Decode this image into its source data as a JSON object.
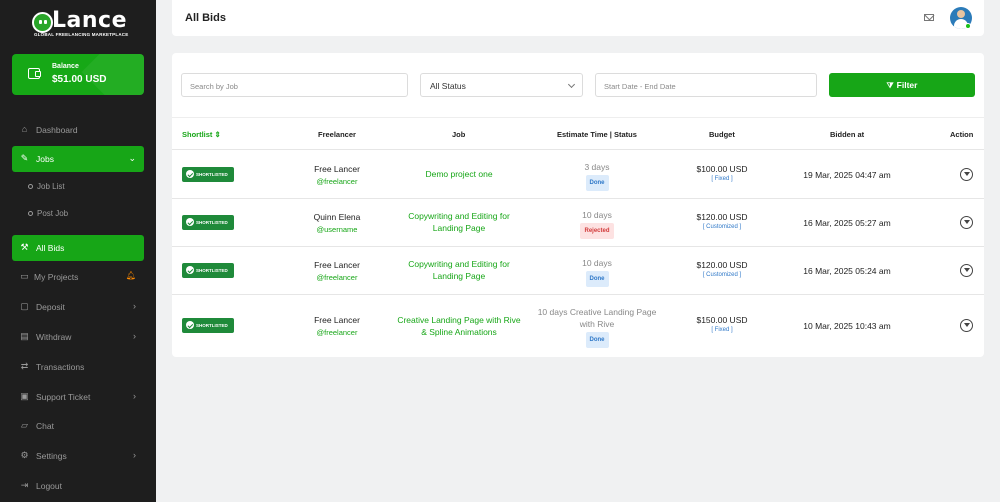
{
  "brand": {
    "name": "Lance",
    "tagline": "GLOBAL FREELANCING MARKETPLACE"
  },
  "balance": {
    "label": "Balance",
    "value": "$51.00 USD"
  },
  "sidebar": {
    "items": [
      {
        "label": "Dashboard",
        "icon": "home-icon"
      },
      {
        "label": "Jobs",
        "icon": "pen-icon"
      },
      {
        "label": "Job List"
      },
      {
        "label": "Post Job"
      },
      {
        "label": "All Bids",
        "icon": "hammer-icon"
      },
      {
        "label": "My Projects",
        "icon": "folder-icon"
      },
      {
        "label": "Deposit",
        "icon": "wallet-icon"
      },
      {
        "label": "Withdraw",
        "icon": "card-icon"
      },
      {
        "label": "Transactions",
        "icon": "transfer-icon"
      },
      {
        "label": "Support Ticket",
        "icon": "ticket-icon"
      },
      {
        "label": "Chat",
        "icon": "chat-icon"
      },
      {
        "label": "Settings",
        "icon": "gear-icon"
      },
      {
        "label": "Logout",
        "icon": "logout-icon"
      }
    ]
  },
  "header": {
    "title": "All Bids"
  },
  "filters": {
    "search_placeholder": "Search by Job",
    "status_value": "All Status",
    "date_placeholder": "Start Date - End Date",
    "filter_label": "Filter"
  },
  "table": {
    "headers": [
      "Shortlist",
      "Freelancer",
      "Job",
      "Estimate Time | Status",
      "Budget",
      "Bidden at",
      "Action"
    ],
    "shortlist_badge": "SHORTLISTED",
    "rows": [
      {
        "name": "Free Lancer",
        "username": "@freelancer",
        "job": "Demo project one",
        "estimate": "3 days",
        "status": "Done",
        "budget": "$100.00 USD",
        "type": "[ Fixed ]",
        "bidden_at": "19 Mar, 2025 04:47 am"
      },
      {
        "name": "Quinn Elena",
        "username": "@username",
        "job": "Copywriting and Editing for Landing Page",
        "estimate": "10 days",
        "status": "Rejected",
        "budget": "$120.00 USD",
        "type": "[ Customized ]",
        "bidden_at": "16 Mar, 2025 05:27 am"
      },
      {
        "name": "Free Lancer",
        "username": "@freelancer",
        "job": "Copywriting and Editing for Landing Page",
        "estimate": "10 days",
        "status": "Done",
        "budget": "$120.00 USD",
        "type": "[ Customized ]",
        "bidden_at": "16 Mar, 2025 05:24 am"
      },
      {
        "name": "Free Lancer",
        "username": "@freelancer",
        "job": "Creative Landing Page with Rive & Spline Animations",
        "estimate": "10 days Creative Landing Page with Rive",
        "status": "Done",
        "budget": "$150.00 USD",
        "type": "[ Fixed ]",
        "bidden_at": "10 Mar, 2025 10:43 am"
      }
    ]
  },
  "colors": {
    "accent": "#17a617",
    "sidebar_bg": "#1e1e1e",
    "badge": "#1f8a3a",
    "done": "#2f78c8",
    "rejected": "#d23a3a"
  }
}
